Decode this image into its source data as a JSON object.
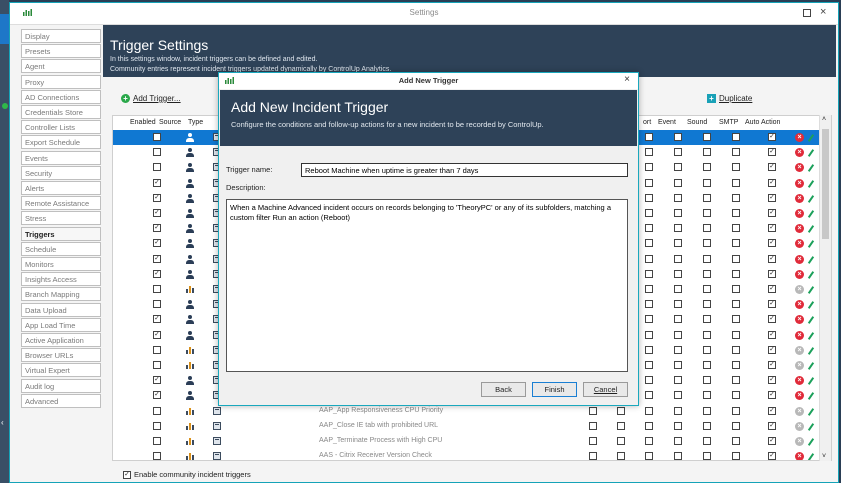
{
  "window": {
    "title": "Settings",
    "minimize_icon": "maximize-icon",
    "close_label": "×"
  },
  "sidebar": {
    "items": [
      {
        "label": "Display"
      },
      {
        "label": "Presets"
      },
      {
        "label": "Agent"
      },
      {
        "label": "Proxy"
      },
      {
        "label": "AD Connections"
      },
      {
        "label": "Credentials Store"
      },
      {
        "label": "Controller Lists"
      },
      {
        "label": "Export Schedule"
      },
      {
        "label": "Events"
      },
      {
        "label": "Security"
      },
      {
        "label": "Alerts"
      },
      {
        "label": "Remote Assistance"
      },
      {
        "label": "Stress"
      },
      {
        "label": "Triggers"
      },
      {
        "label": "Schedule"
      },
      {
        "label": "Monitors"
      },
      {
        "label": "Insights Access"
      },
      {
        "label": "Branch Mapping"
      },
      {
        "label": "Data Upload"
      },
      {
        "label": "App Load Time"
      },
      {
        "label": "Active Application"
      },
      {
        "label": "Browser URLs"
      },
      {
        "label": "Virtual Expert"
      },
      {
        "label": "Audit log"
      },
      {
        "label": "Advanced"
      }
    ],
    "active": "Triggers"
  },
  "header": {
    "title": "Trigger Settings",
    "desc1": "In this settings window, incident triggers can be defined and edited.",
    "desc2": "Community entries represent incident triggers updated dynamically by ControlUp Analytics."
  },
  "toolbar": {
    "add_label": "Add Trigger...",
    "duplicate_label": "Duplicate"
  },
  "grid": {
    "columns": {
      "enabled": "Enabled",
      "source": "Source",
      "type": "Type",
      "port": "ort",
      "event": "Event",
      "sound": "Sound",
      "smtp": "SMTP",
      "auto_action": "Auto Action"
    },
    "rows": [
      {
        "enabled": false,
        "source": "user",
        "name": "",
        "selected": true,
        "auto": true,
        "delete": "red"
      },
      {
        "enabled": false,
        "source": "user",
        "name": "",
        "auto": true,
        "delete": "red"
      },
      {
        "enabled": false,
        "source": "user",
        "name": "",
        "auto": true,
        "delete": "red"
      },
      {
        "enabled": true,
        "source": "user",
        "name": "",
        "auto": true,
        "delete": "red"
      },
      {
        "enabled": true,
        "source": "user",
        "name": "",
        "auto": true,
        "delete": "red"
      },
      {
        "enabled": true,
        "source": "user",
        "name": "",
        "auto": true,
        "delete": "red"
      },
      {
        "enabled": true,
        "source": "user",
        "name": "",
        "auto": true,
        "delete": "red"
      },
      {
        "enabled": true,
        "source": "user",
        "name": "",
        "auto": true,
        "delete": "red"
      },
      {
        "enabled": true,
        "source": "user",
        "name": "",
        "auto": true,
        "delete": "red"
      },
      {
        "enabled": true,
        "source": "user",
        "name": "",
        "auto": true,
        "delete": "red"
      },
      {
        "enabled": false,
        "source": "community",
        "name": "",
        "auto": true,
        "delete": "gray"
      },
      {
        "enabled": false,
        "source": "user",
        "name": "",
        "auto": true,
        "delete": "red"
      },
      {
        "enabled": true,
        "source": "user",
        "name": "",
        "auto": true,
        "delete": "red"
      },
      {
        "enabled": true,
        "source": "user",
        "name": "",
        "auto": true,
        "delete": "red"
      },
      {
        "enabled": false,
        "source": "community",
        "name": "",
        "auto": true,
        "delete": "gray"
      },
      {
        "enabled": false,
        "source": "community",
        "name": "",
        "auto": true,
        "delete": "gray"
      },
      {
        "enabled": true,
        "source": "user",
        "name": "",
        "auto": true,
        "delete": "red"
      },
      {
        "enabled": true,
        "source": "user",
        "name": "",
        "auto": true,
        "delete": "red"
      },
      {
        "enabled": false,
        "source": "community",
        "name": "AAP_App Responsiveness CPU Priority",
        "auto": true,
        "delete": "gray"
      },
      {
        "enabled": false,
        "source": "community",
        "name": "AAP_Close IE tab with prohibited URL",
        "auto": true,
        "delete": "gray"
      },
      {
        "enabled": false,
        "source": "community",
        "name": "AAP_Terminate Process with High CPU",
        "auto": true,
        "delete": "gray"
      },
      {
        "enabled": false,
        "source": "community",
        "name": "AAS - Citrix Receiver Version Check",
        "auto": true,
        "delete": "red"
      }
    ]
  },
  "community_toggle": {
    "label": "Enable community incident triggers",
    "checked": true
  },
  "dialog": {
    "window_title": "Add New Trigger",
    "close_label": "×",
    "heading": "Add New Incident Trigger",
    "subheading": "Configure the conditions and follow-up actions for a new incident to be recorded by ControlUp.",
    "name_label": "Trigger name:",
    "name_value": "Reboot Machine when uptime is greater than 7 days",
    "desc_label": "Description:",
    "desc_value": "When a Machine Advanced incident occurs on records belonging to 'TheoryPC' or any of its subfolders, matching a custom filter Run an action (Reboot)",
    "back_label": "Back",
    "finish_label": "Finish",
    "cancel_label": "Cancel"
  }
}
